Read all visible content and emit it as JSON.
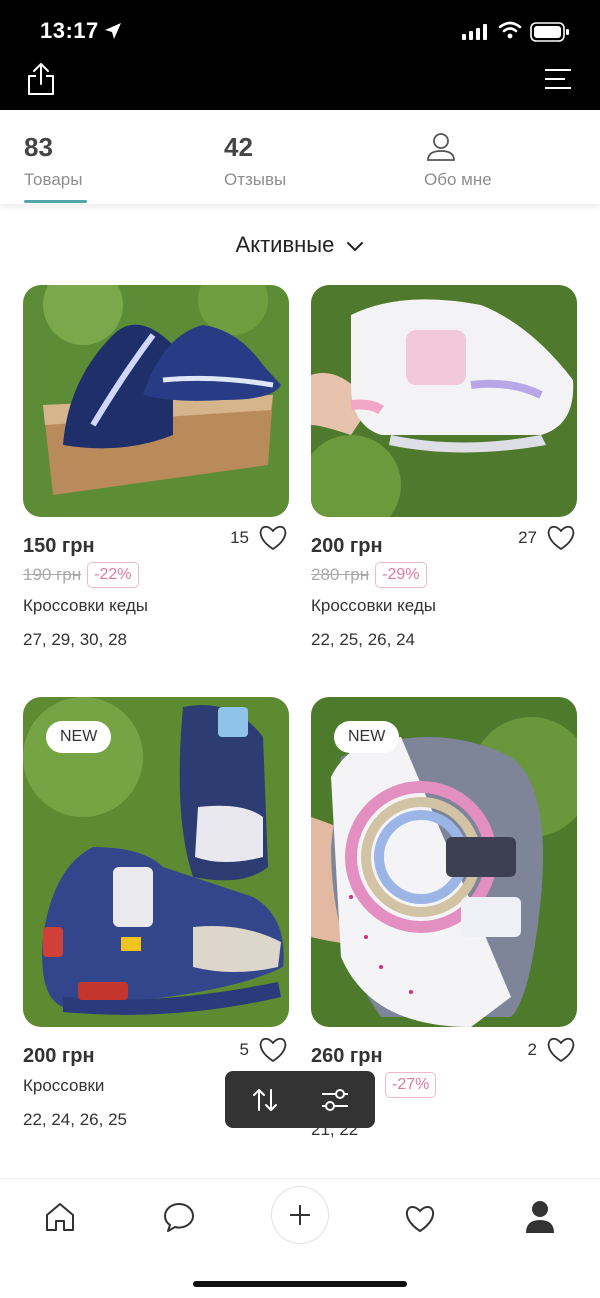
{
  "status_bar": {
    "time": "13:17"
  },
  "stats": {
    "goods": {
      "count": "83",
      "label": "Товары"
    },
    "reviews": {
      "count": "42",
      "label": "Отзывы"
    },
    "about": {
      "label": "Обо мне"
    }
  },
  "filter": {
    "label": "Активные"
  },
  "products": [
    {
      "price": "150 грн",
      "likes": "15",
      "old_price": "190 грн",
      "discount": "-22%",
      "name": "Кроссовки кеды",
      "sizes": "27, 29, 30, 28",
      "new": false
    },
    {
      "price": "200 грн",
      "likes": "27",
      "old_price": "280 грн",
      "discount": "-29%",
      "name": "Кроссовки кеды",
      "sizes": "22, 25, 26, 24",
      "new": false
    },
    {
      "price": "200 грн",
      "likes": "5",
      "name": "Кроссовки",
      "sizes": "22, 24, 26, 25",
      "new": true,
      "badge": "NEW"
    },
    {
      "price": "260 грн",
      "likes": "2",
      "discount": "-27%",
      "sizes": "21, 22",
      "new": true,
      "badge": "NEW"
    }
  ],
  "icons": {
    "share": "share-icon",
    "menu": "menu-icon",
    "about": "user-outline-icon",
    "sort": "sort-icon",
    "filter": "sliders-icon",
    "home": "home-icon",
    "chat": "chat-icon",
    "add": "plus-icon",
    "fav": "heart-icon",
    "profile": "profile-icon"
  },
  "colors": {
    "accent": "#4fa6a6",
    "discount": "#e07aa0",
    "status_bar": "#000000"
  }
}
